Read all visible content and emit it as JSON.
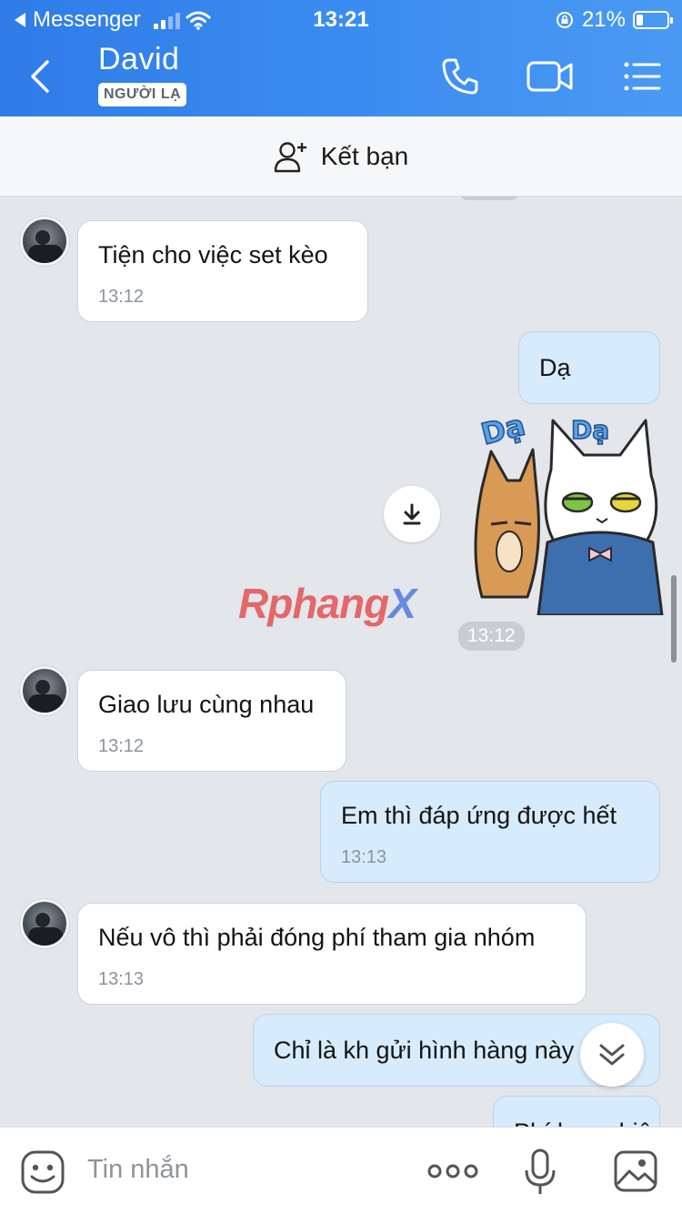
{
  "status": {
    "back_app": "Messenger",
    "time": "13:21",
    "battery": "21%",
    "battery_level": 0.21
  },
  "header": {
    "contact_name": "David",
    "badge": "NGƯỜI LẠ",
    "icons": [
      "back-icon",
      "phone-icon",
      "video-call-icon",
      "menu-icon"
    ]
  },
  "friend_bar": {
    "label": "Kết bạn"
  },
  "messages": [
    {
      "side": "in",
      "text": "Tiện cho việc set kèo",
      "time": "13:12"
    },
    {
      "side": "out",
      "text": "Dạ",
      "time": ""
    },
    {
      "side": "out",
      "type": "sticker",
      "sticker_text": [
        "Dạ",
        "Dạ"
      ],
      "time": "13:12"
    },
    {
      "side": "in",
      "text": "Giao lưu cùng nhau",
      "time": "13:12"
    },
    {
      "side": "out",
      "text": "Em thì đáp ứng được hết",
      "time": "13:13"
    },
    {
      "side": "in",
      "text": "Nếu vô thì phải đóng phí tham gia nhóm",
      "time": "13:13"
    },
    {
      "side": "out",
      "text": "Chỉ là kh gửi hình hàng này",
      "time": ""
    },
    {
      "side": "out",
      "text": "Phí bao nhiêu",
      "time": ""
    }
  ],
  "watermark": {
    "part1": "Rphang",
    "part2": "X"
  },
  "composer": {
    "placeholder": "Tin nhắn"
  },
  "colors": {
    "header_blue": "#3a8bf0",
    "outgoing_bubble": "#d6ebfb",
    "incoming_bubble": "#ffffff",
    "chat_bg": "#e3e6eb"
  }
}
